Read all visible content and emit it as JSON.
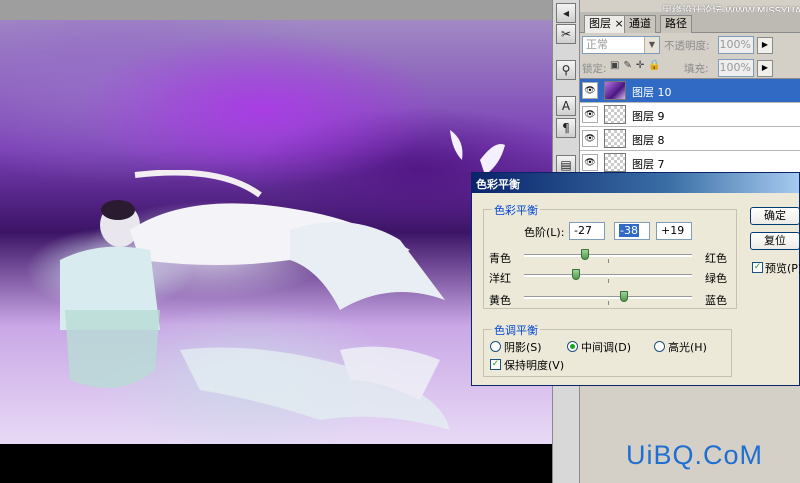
{
  "layers_panel": {
    "tabs": [
      {
        "label": "图层"
      },
      {
        "label": "通道"
      },
      {
        "label": "路径"
      }
    ],
    "tab_close": "×",
    "watermark": "思缘设计论坛 WWW.MISSYUAN.COM",
    "blend_mode": "正常",
    "opacity_label": "不透明度:",
    "opacity_value": "100%",
    "lock_label": "锁定:",
    "fill_label": "填充:",
    "fill_value": "100%",
    "layers": [
      {
        "name": "图层 10",
        "selected": true
      },
      {
        "name": "图层 9"
      },
      {
        "name": "图层 8"
      },
      {
        "name": "图层 7"
      }
    ]
  },
  "dialog": {
    "title": "色彩平衡",
    "color_balance_group": "色彩平衡",
    "levels_label": "色阶(L):",
    "levels": [
      "-27",
      "-38",
      "+19"
    ],
    "sliders": [
      {
        "left": "青色",
        "right": "红色",
        "value": -27
      },
      {
        "left": "洋红",
        "right": "绿色",
        "value": -38
      },
      {
        "left": "黄色",
        "right": "蓝色",
        "value": 19
      }
    ],
    "tone_group": "色调平衡",
    "tones": [
      {
        "label": "阴影(S)",
        "selected": false
      },
      {
        "label": "中间调(D)",
        "selected": true
      },
      {
        "label": "高光(H)",
        "selected": false
      }
    ],
    "preserve_luminosity": "保持明度(V)",
    "ok": "确定",
    "reset": "复位",
    "preview": "预览(P)"
  },
  "site_logo": "UiBQ.CoM"
}
